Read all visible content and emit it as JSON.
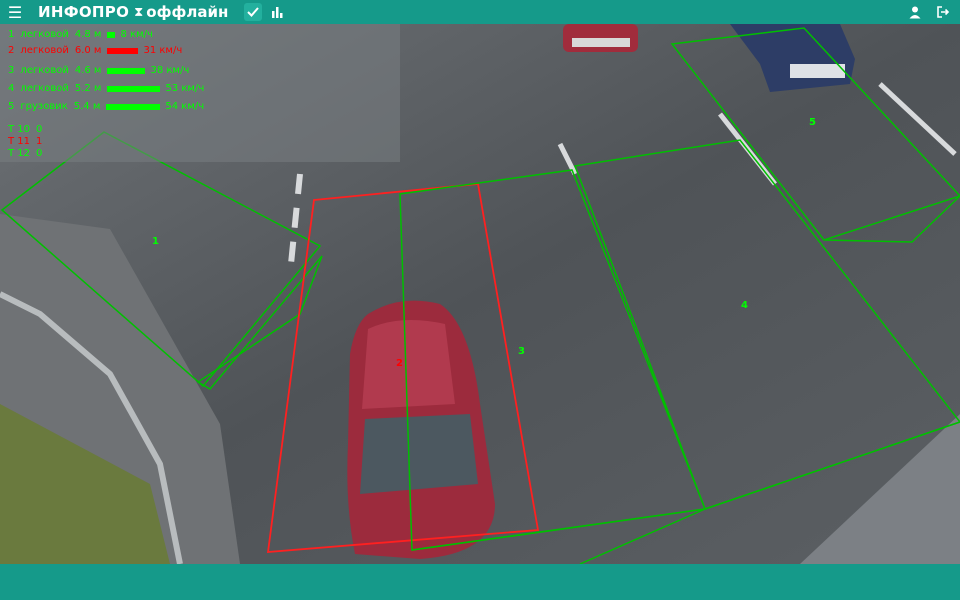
{
  "app": {
    "title": "ИНФОПРО",
    "hourglass": "⧗",
    "status": "оффлайн"
  },
  "icons": {
    "menu": "menu-icon",
    "check": "check-icon",
    "chart": "bar-chart-icon",
    "user": "user-icon",
    "logout": "logout-icon"
  },
  "colors": {
    "accent": "#159a8a",
    "ok": "#00ff00",
    "alert": "#ff0000"
  },
  "lanes": [
    {
      "id": "1",
      "type": "легковой",
      "length": "4.8 м",
      "speed": "8 км/ч",
      "level": 0.1,
      "color": "#00ff00"
    },
    {
      "id": "2",
      "type": "легковой",
      "length": "6.0 м",
      "speed": "31 км/ч",
      "level": 0.39,
      "color": "#ff0000"
    },
    {
      "id": "3",
      "type": "легковой",
      "length": "4.6 м",
      "speed": "38 км/ч",
      "level": 0.48,
      "color": "#00ff00"
    },
    {
      "id": "4",
      "type": "легковой",
      "length": "5.2 м",
      "speed": "53 км/ч",
      "level": 0.66,
      "color": "#00ff00"
    },
    {
      "id": "5",
      "type": "грузовик",
      "length": "5.4 м",
      "speed": "54 км/ч",
      "level": 0.68,
      "color": "#00ff00"
    }
  ],
  "timers": [
    {
      "label": "Т 10",
      "value": "0",
      "color": "#00ff00"
    },
    {
      "label": "Т 11",
      "value": "1",
      "color": "#ff0000"
    },
    {
      "label": "Т 12",
      "value": "0",
      "color": "#00ff00"
    }
  ],
  "zones": [
    {
      "label": "1",
      "color": "#00ff00"
    },
    {
      "label": "2",
      "color": "#ff0000"
    },
    {
      "label": "3",
      "color": "#00ff00"
    },
    {
      "label": "4",
      "color": "#00ff00"
    },
    {
      "label": "5",
      "color": "#00ff00"
    }
  ]
}
